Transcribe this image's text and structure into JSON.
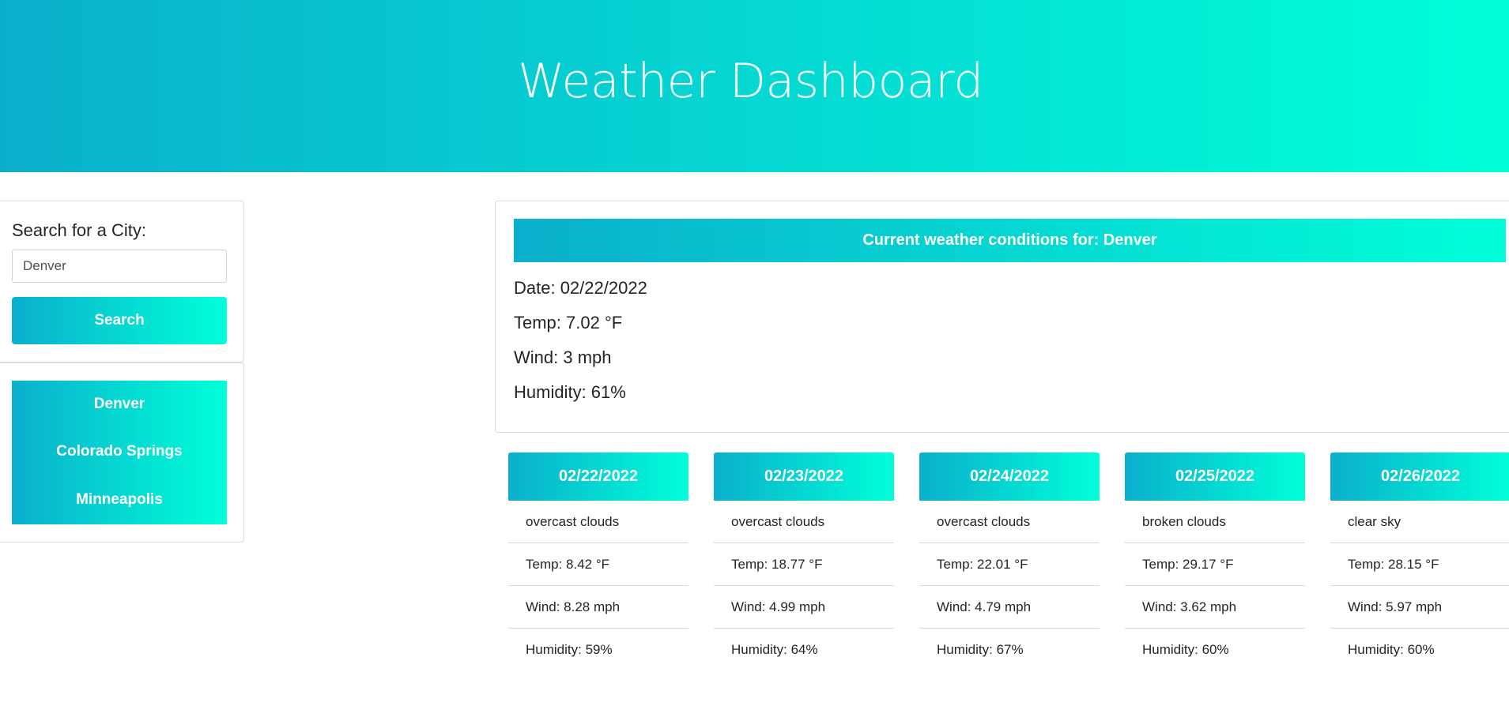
{
  "header": {
    "title": "Weather Dashboard"
  },
  "search": {
    "label": "Search for a City:",
    "input_value": "Denver",
    "button_label": "Search"
  },
  "history": [
    "Denver",
    "Colorado Springs",
    "Minneapolis"
  ],
  "current": {
    "title": "Current weather conditions for: Denver",
    "date": "Date: 02/22/2022",
    "temp": "Temp: 7.02 °F",
    "wind": "Wind: 3 mph",
    "humidity": "Humidity: 61%"
  },
  "forecast": [
    {
      "date": "02/22/2022",
      "desc": "overcast clouds",
      "temp": "Temp: 8.42 °F",
      "wind": "Wind: 8.28 mph",
      "humidity": "Humidity: 59%"
    },
    {
      "date": "02/23/2022",
      "desc": "overcast clouds",
      "temp": "Temp: 18.77 °F",
      "wind": "Wind: 4.99 mph",
      "humidity": "Humidity: 64%"
    },
    {
      "date": "02/24/2022",
      "desc": "overcast clouds",
      "temp": "Temp: 22.01 °F",
      "wind": "Wind: 4.79 mph",
      "humidity": "Humidity: 67%"
    },
    {
      "date": "02/25/2022",
      "desc": "broken clouds",
      "temp": "Temp: 29.17 °F",
      "wind": "Wind: 3.62 mph",
      "humidity": "Humidity: 60%"
    },
    {
      "date": "02/26/2022",
      "desc": "clear sky",
      "temp": "Temp: 28.15 °F",
      "wind": "Wind: 5.97 mph",
      "humidity": "Humidity: 60%"
    }
  ],
  "colors": {
    "gradient_start": "#0aafcc",
    "gradient_end": "#00ffd8",
    "text": "#212529"
  }
}
